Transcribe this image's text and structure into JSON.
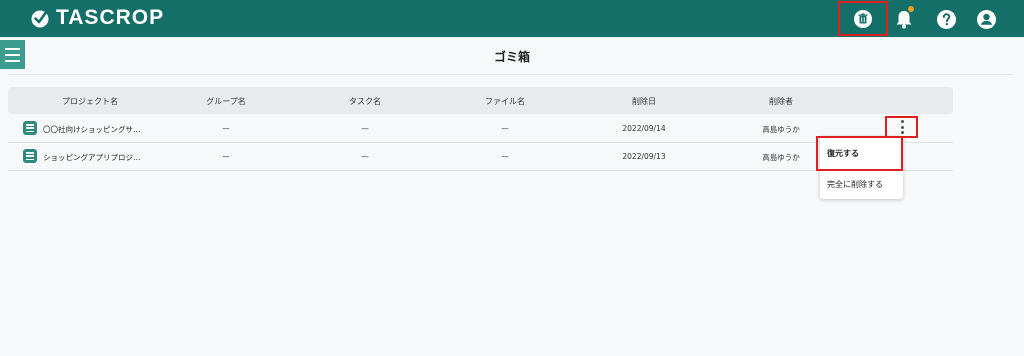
{
  "app": {
    "logo_text": "TASCROP"
  },
  "header_icons": [
    "trash-icon",
    "bell-icon",
    "help-icon",
    "user-icon"
  ],
  "colors": {
    "header": "#146f68",
    "accent": "#3c9c90",
    "highlight": "#e0201f",
    "notification": "#f0a020"
  },
  "page": {
    "title": "ゴミ箱"
  },
  "table": {
    "headers": [
      "プロジェクト名",
      "グループ名",
      "タスク名",
      "ファイル名",
      "削除日",
      "削除者"
    ],
    "rows": [
      {
        "project": "〇〇社向けショッピングサ…",
        "group": "—",
        "task": "—",
        "file": "—",
        "deleted_date": "2022/09/14",
        "deleted_by": "高島ゆうか"
      },
      {
        "project": "ショッピングアプリプロジ…",
        "group": "—",
        "task": "—",
        "file": "—",
        "deleted_date": "2022/09/13",
        "deleted_by": "高島ゆうか"
      }
    ]
  },
  "row_menu": {
    "restore_label": "復元する",
    "delete_label": "完全に削除する"
  }
}
